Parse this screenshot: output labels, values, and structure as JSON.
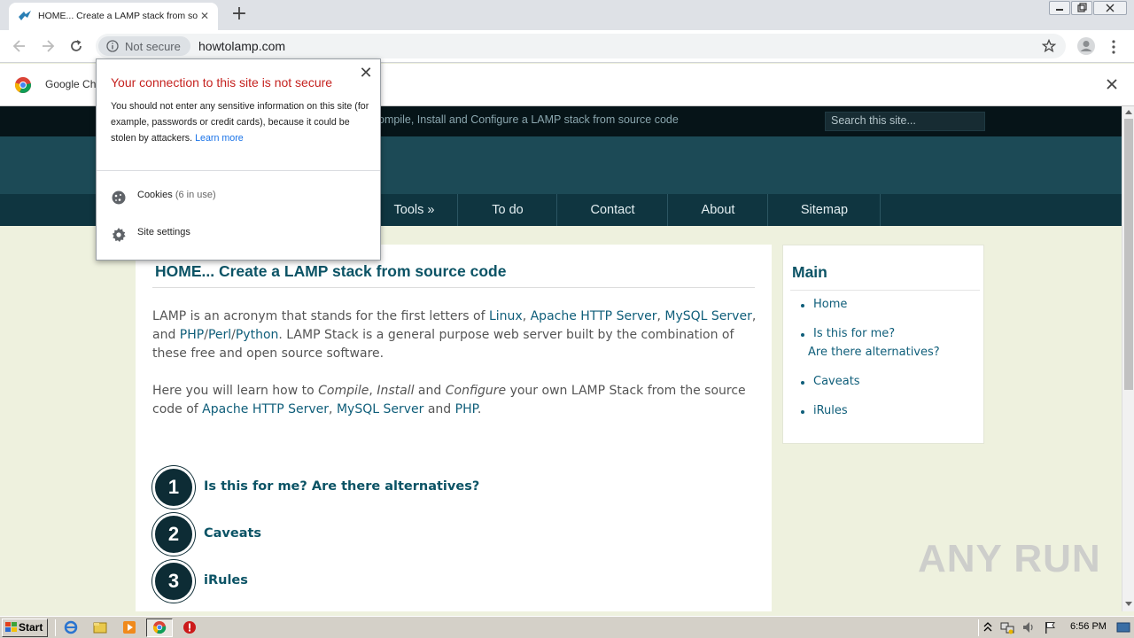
{
  "browser": {
    "tab": {
      "title": "HOME... Create a LAMP stack from source code"
    },
    "security_chip": "Not secure",
    "url": "howtolamp.com",
    "infobar_text": "Google Ch"
  },
  "popup": {
    "heading": "Your connection to this site is not secure",
    "body": "You should not enter any sensitive information on this site (for example, passwords or credit cards), because it could be stolen by attackers.",
    "learn_more": "Learn more",
    "cookies_label": "Cookies",
    "cookies_count": "(6 in use)",
    "site_settings_label": "Site settings"
  },
  "site": {
    "tagline": "ompile, Install and Configure a LAMP stack from source code",
    "search_placeholder": "Search this site...",
    "nav": [
      {
        "label": "Tools »"
      },
      {
        "label": "To do"
      },
      {
        "label": "Contact"
      },
      {
        "label": "About"
      },
      {
        "label": "Sitemap"
      }
    ],
    "page_title": "HOME... Create a LAMP stack from source code",
    "para1": {
      "t1": "LAMP is an acronym that stands for the first letters of ",
      "l1": "Linux",
      "t2": ", ",
      "l2": "Apache HTTP Server",
      "t3": ", ",
      "l3": "MySQL Server",
      "t4": ", and ",
      "l4": "PHP",
      "t5": "/",
      "l5": "Perl",
      "t6": "/",
      "l6": "Python",
      "t7": ". LAMP Stack is a general purpose web server built by the combination of these free and open source software."
    },
    "para2": {
      "t1": "Here you will learn how to ",
      "e1": "Compile",
      "t2": ", ",
      "e2": "Install",
      "t3": " and ",
      "e3": "Configure",
      "t4": " your own LAMP Stack from the source code of ",
      "l1": "Apache HTTP Server",
      "t5": ", ",
      "l2": "MySQL Server",
      "t6": " and ",
      "l3": "PHP",
      "t7": "."
    },
    "steps": [
      {
        "num": "1",
        "label": "Is this for me? Are there alternatives?"
      },
      {
        "num": "2",
        "label": "Caveats"
      },
      {
        "num": "3",
        "label": "iRules"
      }
    ],
    "sidebar": {
      "title": "Main",
      "links": [
        "Home",
        "Is this for me?",
        "Are there alternatives?",
        "Caveats",
        "iRules"
      ]
    }
  },
  "taskbar": {
    "start_label": "Start",
    "clock": "6:56 PM"
  },
  "watermark": "ANY RUN"
}
